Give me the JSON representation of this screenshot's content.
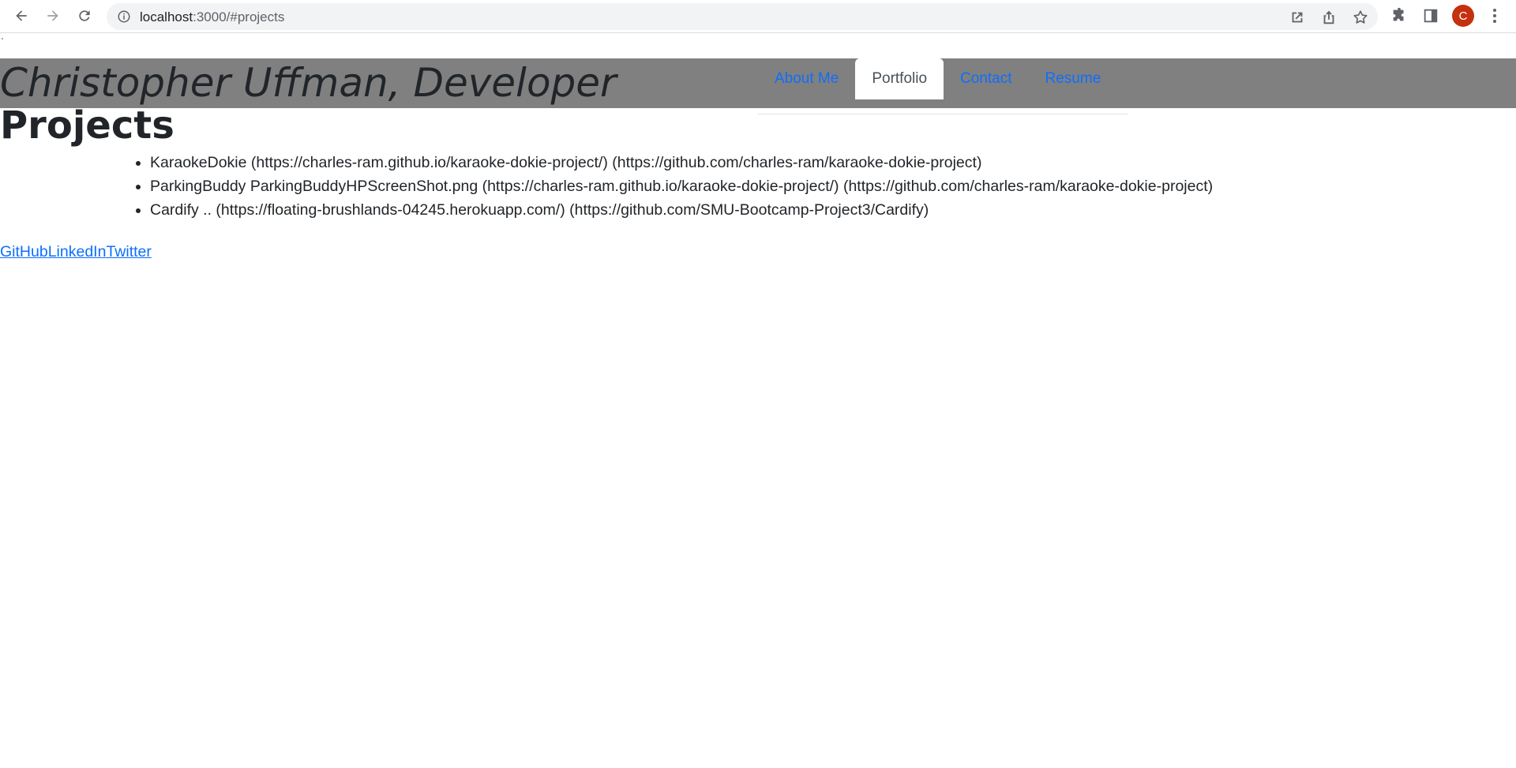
{
  "browser": {
    "url_host": "localhost",
    "url_rest": ":3000/#projects",
    "profile_initial": "C",
    "icons": [
      "back-icon",
      "forward-icon",
      "reload-icon",
      "info-icon",
      "open-in-app-icon",
      "share-icon",
      "bookmark-star-icon",
      "extensions-icon",
      "side-panel-icon",
      "menu-dots-icon"
    ]
  },
  "page": {
    "stray_mark": "'",
    "site_title": "Christopher Uffman, Developer",
    "nav": [
      {
        "label": "About Me",
        "active": false
      },
      {
        "label": "Portfolio",
        "active": true
      },
      {
        "label": "Contact",
        "active": false
      },
      {
        "label": "Resume",
        "active": false
      }
    ],
    "section_heading": "Projects",
    "projects": [
      "KaraokeDokie (https://charles-ram.github.io/karaoke-dokie-project/) (https://github.com/charles-ram/karaoke-dokie-project)",
      "ParkingBuddy ParkingBuddyHPScreenShot.png (https://charles-ram.github.io/karaoke-dokie-project/) (https://github.com/charles-ram/karaoke-dokie-project)",
      "Cardify .. (https://floating-brushlands-04245.herokuapp.com/) (https://github.com/SMU-Bootcamp-Project3/Cardify)"
    ],
    "footer_links": [
      "GitHub",
      "LinkedIn",
      "Twitter"
    ]
  },
  "colors": {
    "header_bg": "#808080",
    "link": "#0d6efd",
    "avatar": "#c5300f"
  }
}
